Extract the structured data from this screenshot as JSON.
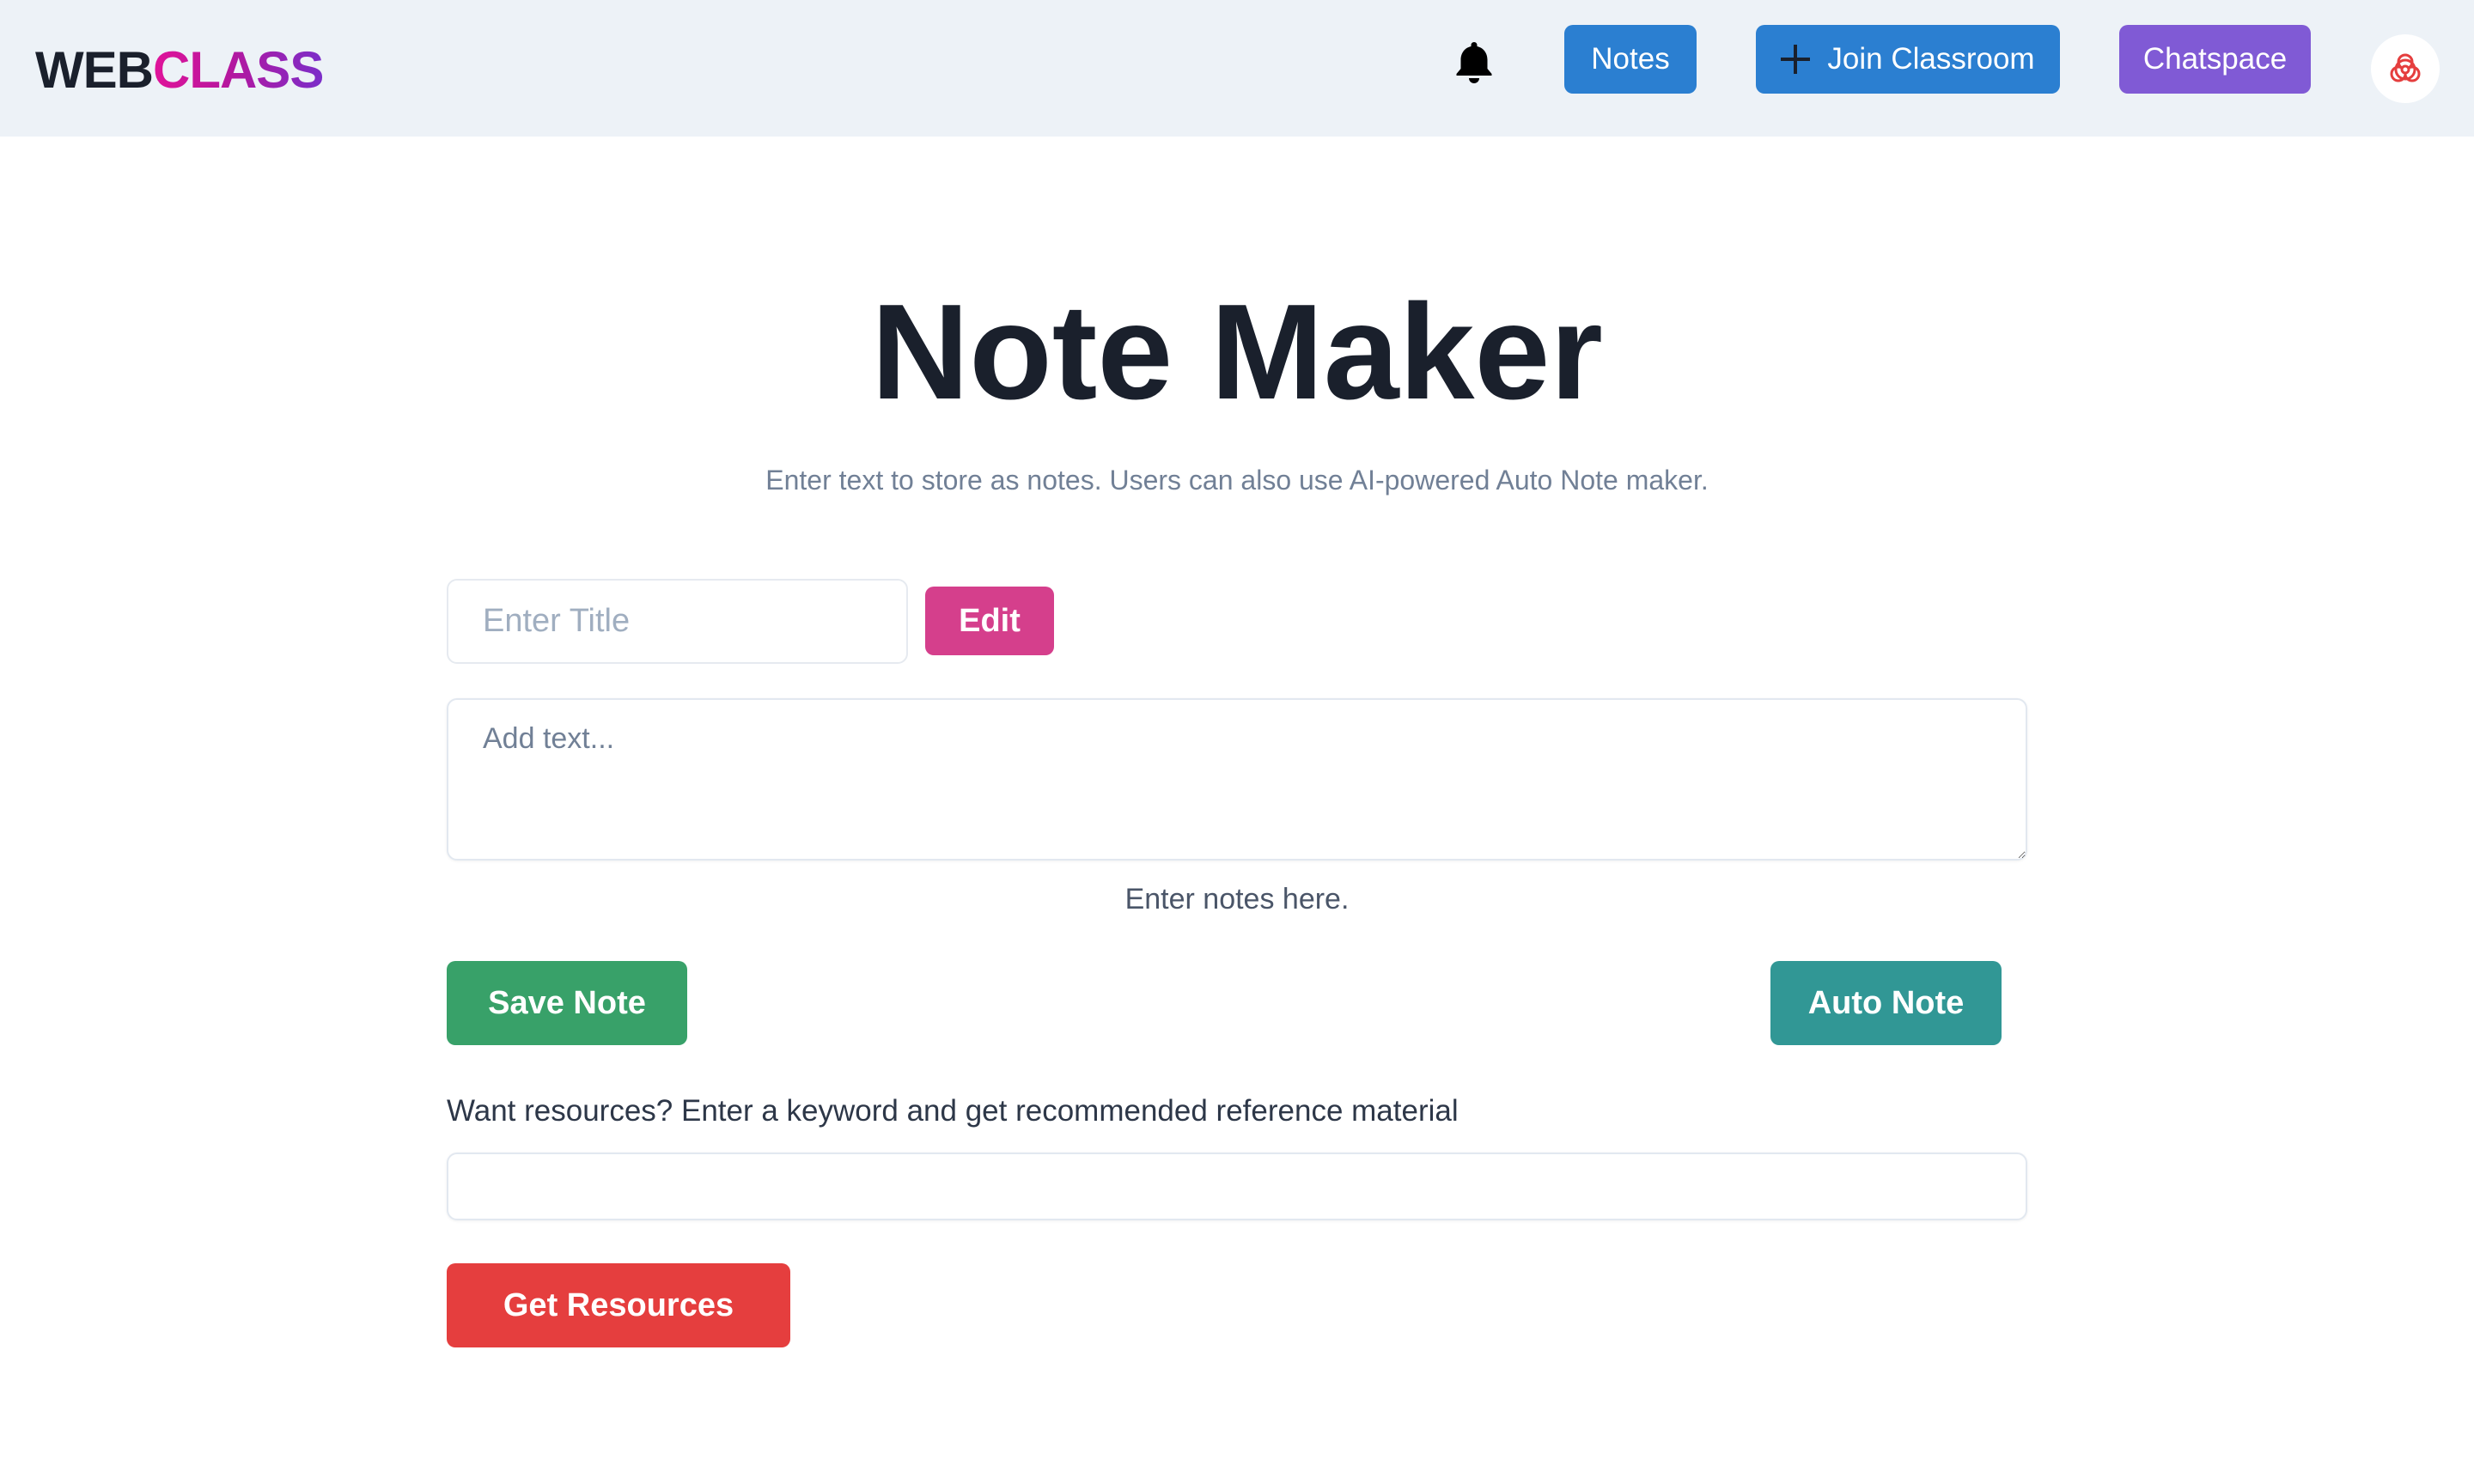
{
  "header": {
    "logo_part1": "WEB",
    "logo_part2": "CLASS",
    "bell_icon": "bell-icon",
    "notes_label": "Notes",
    "join_label": "Join Classroom",
    "chat_label": "Chatspace",
    "avatar_icon": "biohazard-icon"
  },
  "main": {
    "title": "Note Maker",
    "subtitle": "Enter text to store as notes. Users can also use AI-powered Auto Note maker.",
    "title_placeholder": "Enter Title",
    "title_value": "",
    "edit_label": "Edit",
    "text_placeholder": "Add text...",
    "text_value": "",
    "helper_text": "Enter notes here.",
    "save_label": "Save Note",
    "auto_label": "Auto Note",
    "resources_label": "Want resources? Enter a keyword and get recommended reference material",
    "resources_value": "",
    "get_resources_label": "Get Resources"
  },
  "colors": {
    "header_bg": "#edf2f7",
    "primary_blue": "#2b7fd1",
    "purple": "#805ad5",
    "pink": "#d53f8c",
    "green": "#38a169",
    "teal": "#319795",
    "red": "#e53e3e"
  }
}
